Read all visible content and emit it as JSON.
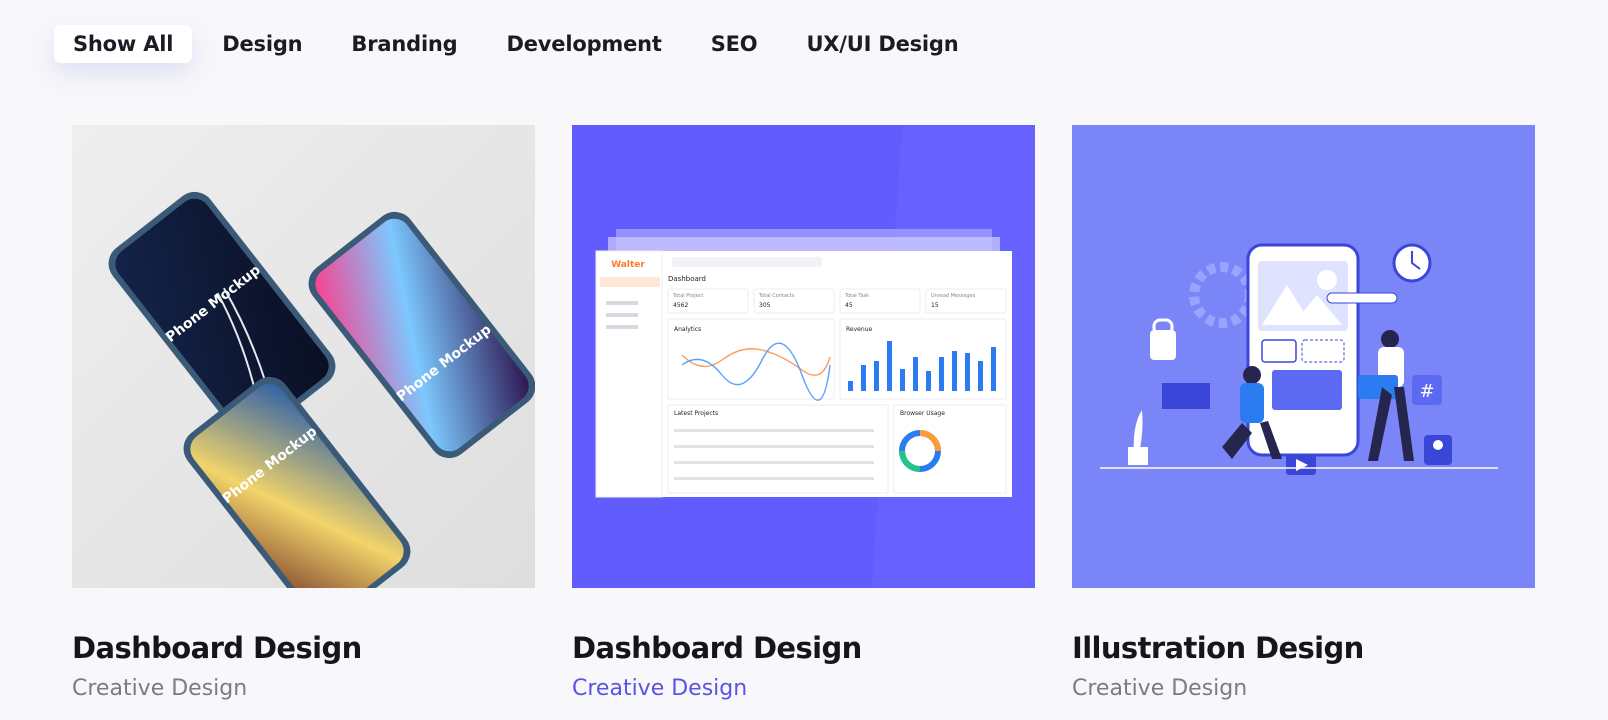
{
  "filters": [
    {
      "label": "Show All",
      "active": true
    },
    {
      "label": "Design",
      "active": false
    },
    {
      "label": "Branding",
      "active": false
    },
    {
      "label": "Development",
      "active": false
    },
    {
      "label": "SEO",
      "active": false
    },
    {
      "label": "UX/UI Design",
      "active": false
    }
  ],
  "cards": [
    {
      "title": "Dashboard Design",
      "category": "Creative Design",
      "category_color": "#7b7b83"
    },
    {
      "title": "Dashboard Design",
      "category": "Creative Design",
      "category_color": "#5b52e6"
    },
    {
      "title": "Illustration Design",
      "category": "Creative Design",
      "category_color": "#7b7b83"
    }
  ],
  "mockup1": {
    "screen_text_1": "Phone Mockup",
    "screen_text_2": "Phone Mockup",
    "screen_text_3": "Phone Mockup"
  },
  "mockup2": {
    "brand": "Walter",
    "heading": "Dashboard",
    "stats": [
      {
        "label": "Total Project",
        "value": "4562"
      },
      {
        "label": "Total Contacts",
        "value": "305"
      },
      {
        "label": "Total Task",
        "value": "45"
      },
      {
        "label": "Unread Messages",
        "value": "15"
      }
    ],
    "analytics_label": "Analytics",
    "revenue_label": "Revenue",
    "projects_label": "Latest Projects",
    "browser_label": "Browser Usage"
  },
  "colors": {
    "accent": "#5b52e6",
    "card2_bg": "#625cff",
    "card3_bg": "#7a86f8"
  }
}
